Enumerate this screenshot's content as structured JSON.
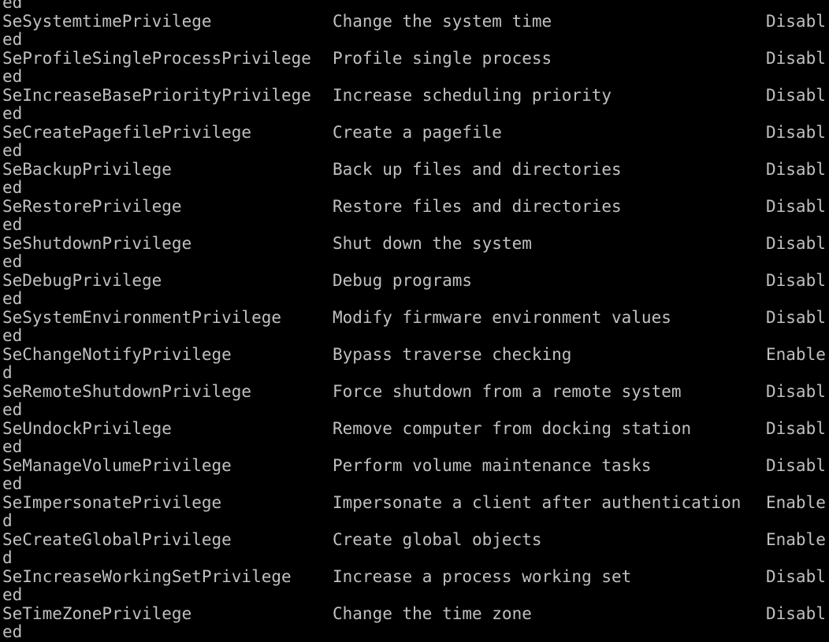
{
  "window": {
    "title": ""
  },
  "console": {
    "leading_fragment": "ed",
    "rows": [
      {
        "name": "SeSystemtimePrivilege",
        "description": "Change the system time",
        "state_head": "Disabl",
        "state_tail": "ed"
      },
      {
        "name": "SeProfileSingleProcessPrivilege",
        "description": "Profile single process",
        "state_head": "Disabl",
        "state_tail": "ed"
      },
      {
        "name": "SeIncreaseBasePriorityPrivilege",
        "description": "Increase scheduling priority",
        "state_head": "Disabl",
        "state_tail": "ed"
      },
      {
        "name": "SeCreatePagefilePrivilege",
        "description": "Create a pagefile",
        "state_head": "Disabl",
        "state_tail": "ed"
      },
      {
        "name": "SeBackupPrivilege",
        "description": "Back up files and directories",
        "state_head": "Disabl",
        "state_tail": "ed"
      },
      {
        "name": "SeRestorePrivilege",
        "description": "Restore files and directories",
        "state_head": "Disabl",
        "state_tail": "ed"
      },
      {
        "name": "SeShutdownPrivilege",
        "description": "Shut down the system",
        "state_head": "Disabl",
        "state_tail": "ed"
      },
      {
        "name": "SeDebugPrivilege",
        "description": "Debug programs",
        "state_head": "Disabl",
        "state_tail": "ed"
      },
      {
        "name": "SeSystemEnvironmentPrivilege",
        "description": "Modify firmware environment values",
        "state_head": "Disabl",
        "state_tail": "ed"
      },
      {
        "name": "SeChangeNotifyPrivilege",
        "description": "Bypass traverse checking",
        "state_head": "Enable",
        "state_tail": "d"
      },
      {
        "name": "SeRemoteShutdownPrivilege",
        "description": "Force shutdown from a remote system",
        "state_head": "Disabl",
        "state_tail": "ed"
      },
      {
        "name": "SeUndockPrivilege",
        "description": "Remove computer from docking station",
        "state_head": "Disabl",
        "state_tail": "ed"
      },
      {
        "name": "SeManageVolumePrivilege",
        "description": "Perform volume maintenance tasks",
        "state_head": "Disabl",
        "state_tail": "ed"
      },
      {
        "name": "SeImpersonatePrivilege",
        "description": "Impersonate a client after authentication",
        "state_head": "Enable",
        "state_tail": "d"
      },
      {
        "name": "SeCreateGlobalPrivilege",
        "description": "Create global objects",
        "state_head": "Enable",
        "state_tail": "d"
      },
      {
        "name": "SeIncreaseWorkingSetPrivilege",
        "description": "Increase a process working set",
        "state_head": "Disabl",
        "state_tail": "ed"
      },
      {
        "name": "SeTimeZonePrivilege",
        "description": "Change the time zone",
        "state_head": "Disabl",
        "state_tail": "ed"
      }
    ]
  },
  "colors": {
    "background": "#000000",
    "text": "#c0c0c0"
  }
}
